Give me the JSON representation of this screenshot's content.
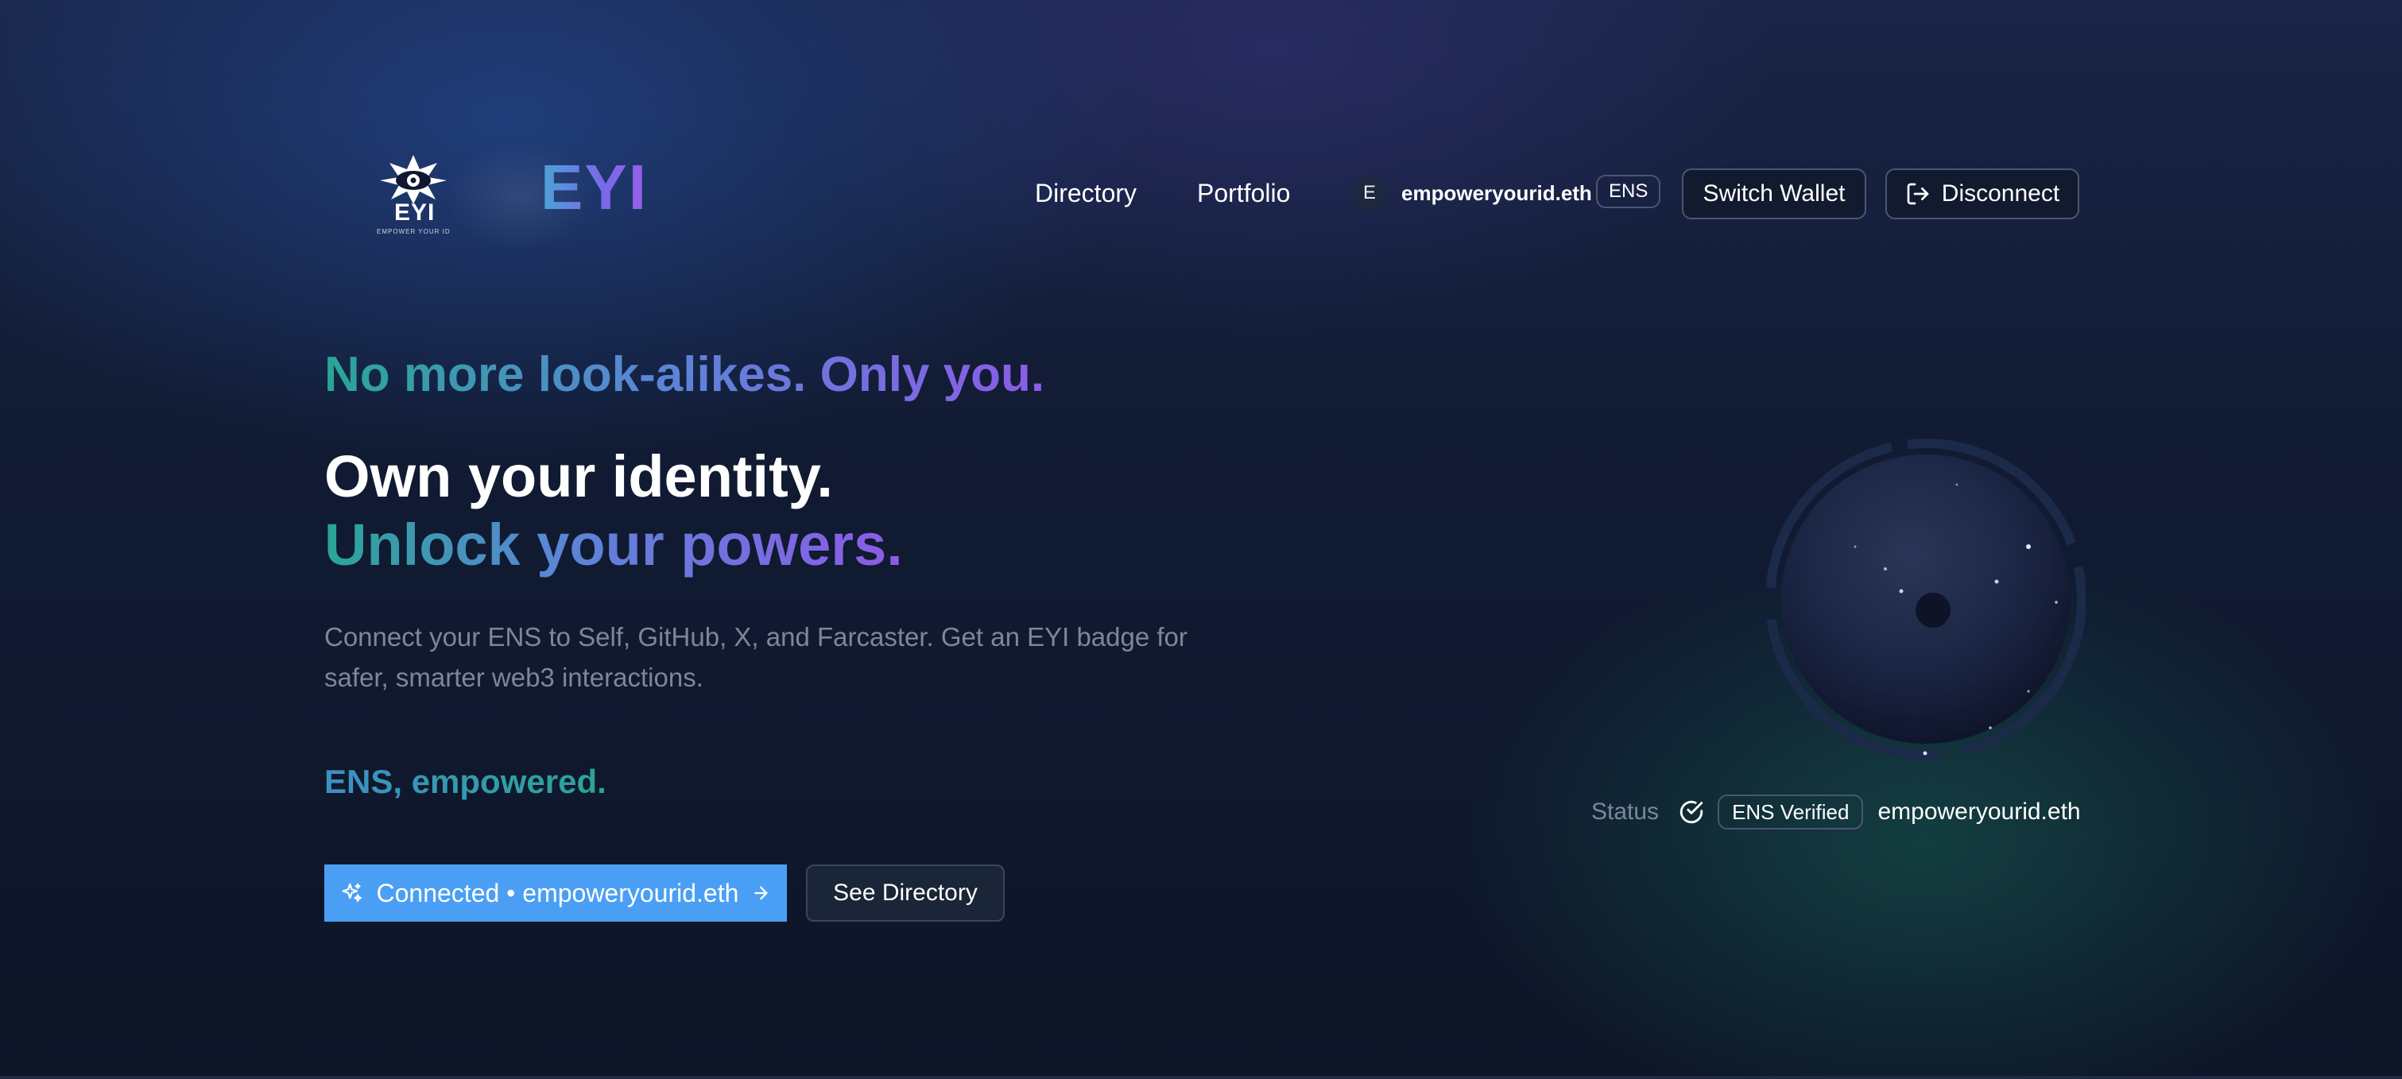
{
  "header": {
    "logo": {
      "mark_text": "EYI",
      "mark_tagline": "EMPOWER YOUR ID",
      "wordmark": "EYI"
    },
    "nav": [
      {
        "label": "Directory"
      },
      {
        "label": "Portfolio"
      }
    ],
    "wallet": {
      "avatar_letter": "E",
      "name": "empoweryourid.eth",
      "badge": "ENS"
    },
    "switch_wallet_label": "Switch Wallet",
    "disconnect_label": "Disconnect"
  },
  "hero": {
    "tagline": "No more look-alikes. Only you.",
    "headline_line1": "Own your identity.",
    "headline_line2": "Unlock your powers.",
    "description": "Connect your ENS to Self, GitHub, X, and Farcaster. Get an EYI badge for safer, smarter web3 interactions.",
    "sub_tagline": "ENS, empowered.",
    "connected_button_label": "Connected • empoweryourid.eth",
    "directory_button_label": "See Directory"
  },
  "status": {
    "label": "Status",
    "badge": "ENS Verified",
    "name": "empoweryourid.eth"
  },
  "icons": {
    "sparkle": "sparkles-icon",
    "arrow": "arrow-right-icon",
    "logout": "logout-icon",
    "check": "check-circle-icon"
  },
  "colors": {
    "primary_button": "#4a9ff5",
    "gradient_start": "#2aa596",
    "gradient_mid": "#5a86d6",
    "gradient_end": "#8c5be6"
  }
}
